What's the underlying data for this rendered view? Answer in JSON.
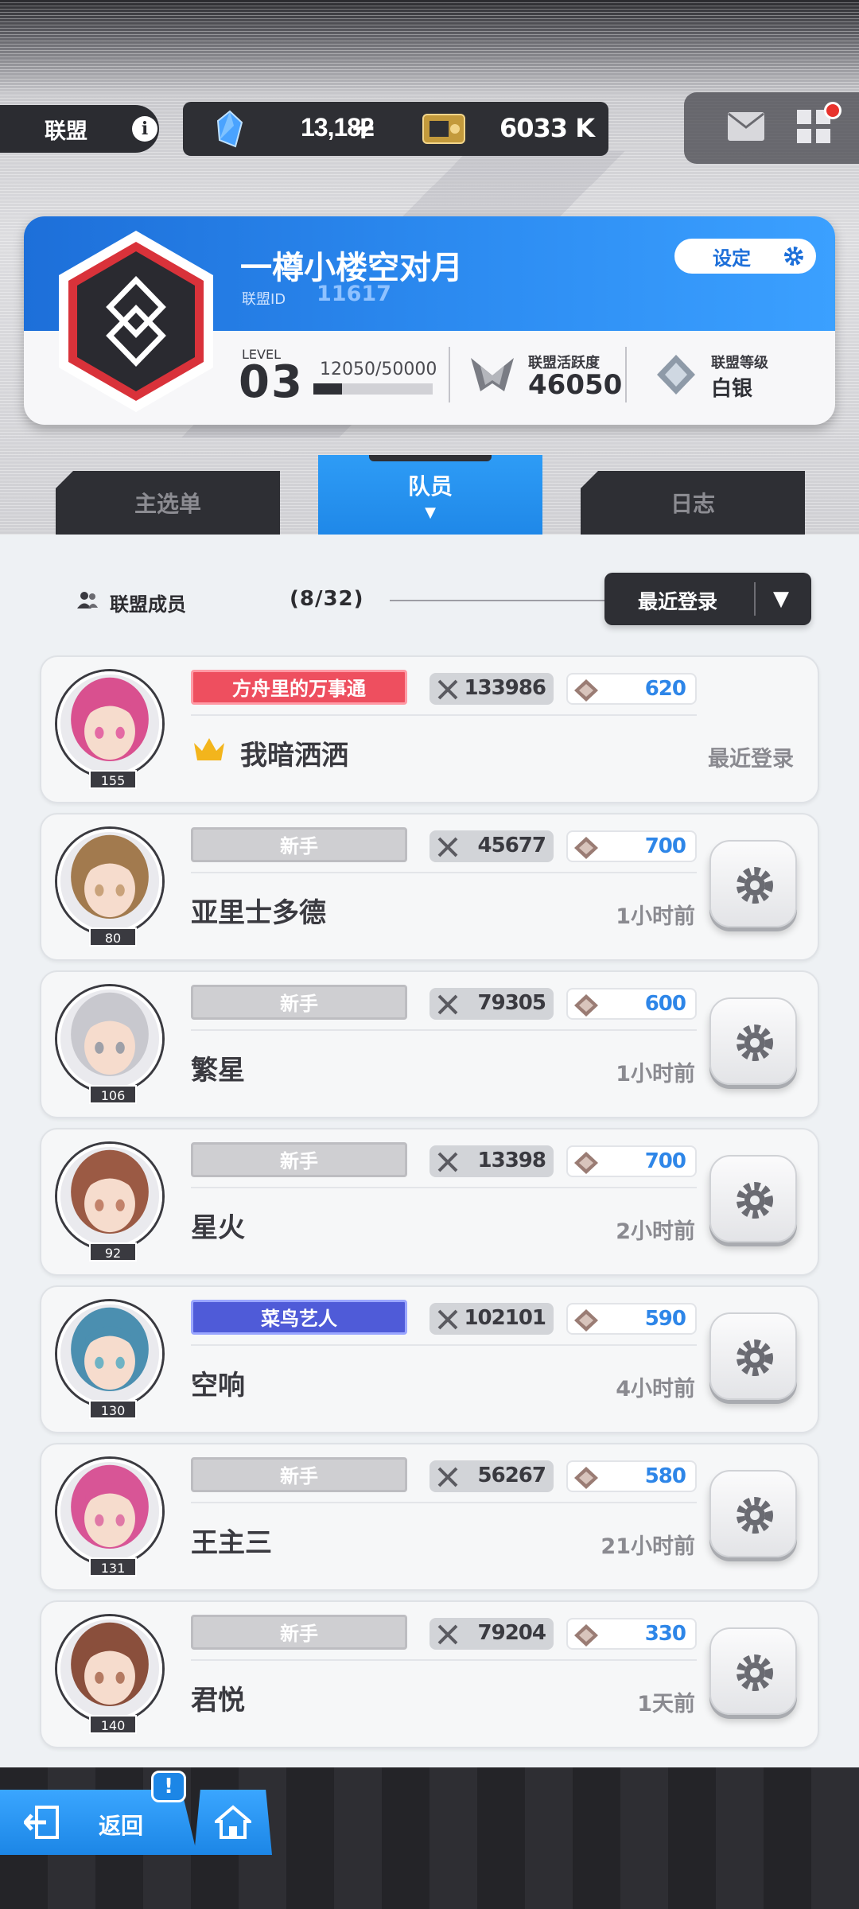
{
  "top_bar": {
    "section_label": "联盟",
    "crystals": "13,182",
    "plus": "+",
    "credits": "6033 K"
  },
  "alliance": {
    "name": "一樽小楼空对月",
    "id_label": "联盟ID",
    "id": "11617",
    "settings_label": "设定",
    "level_label": "LEVEL",
    "level": "03",
    "exp": "12050/50000",
    "exp_progress": 0.241,
    "activity_label": "联盟活跃度",
    "activity": "46050",
    "rank_label": "联盟等级",
    "rank": "白银"
  },
  "tabs": [
    {
      "label": "主选单",
      "active": false
    },
    {
      "label": "队员",
      "active": true
    },
    {
      "label": "日志",
      "active": false
    }
  ],
  "members_header": {
    "label": "联盟成员",
    "count": "(8/32)",
    "sort_selected": "最近登录"
  },
  "members": [
    {
      "level": "155",
      "title": "方舟里的万事通",
      "title_style": "pink",
      "power": "133986",
      "contribution": "620",
      "name": "我暗洒洒",
      "last_login": "最近登录",
      "leader": true
    },
    {
      "level": "80",
      "title": "新手",
      "title_style": "gray",
      "power": "45677",
      "contribution": "700",
      "name": "亚里士多德",
      "last_login": "1小时前",
      "leader": false
    },
    {
      "level": "106",
      "title": "新手",
      "title_style": "gray",
      "power": "79305",
      "contribution": "600",
      "name": "繁星",
      "last_login": "1小时前",
      "leader": false
    },
    {
      "level": "92",
      "title": "新手",
      "title_style": "gray",
      "power": "13398",
      "contribution": "700",
      "name": "星火",
      "last_login": "2小时前",
      "leader": false
    },
    {
      "level": "130",
      "title": "菜鸟艺人",
      "title_style": "purple",
      "power": "102101",
      "contribution": "590",
      "name": "空响",
      "last_login": "4小时前",
      "leader": false
    },
    {
      "level": "131",
      "title": "新手",
      "title_style": "gray",
      "power": "56267",
      "contribution": "580",
      "name": "王主三",
      "last_login": "21小时前",
      "leader": false
    },
    {
      "level": "140",
      "title": "新手",
      "title_style": "gray",
      "power": "79204",
      "contribution": "330",
      "name": "君悦",
      "last_login": "1天前",
      "leader": false
    }
  ],
  "bottom": {
    "back_label": "返回",
    "alert": "!"
  },
  "colors": {
    "accent_blue": "#1d86e6",
    "dark_panel": "#2e2f34",
    "pink_title": "#ee4f5f",
    "purple_title": "#4f5bd8"
  },
  "icons": [
    "info-icon",
    "crystal-icon",
    "plus-icon",
    "credit-box-icon",
    "mail-icon",
    "menu-grid-icon",
    "gear-icon",
    "activity-icon",
    "rank-icon",
    "members-icon",
    "dropdown-arrow-icon",
    "crown-icon",
    "swords-icon",
    "gem-icon",
    "exit-door-icon",
    "home-icon"
  ]
}
